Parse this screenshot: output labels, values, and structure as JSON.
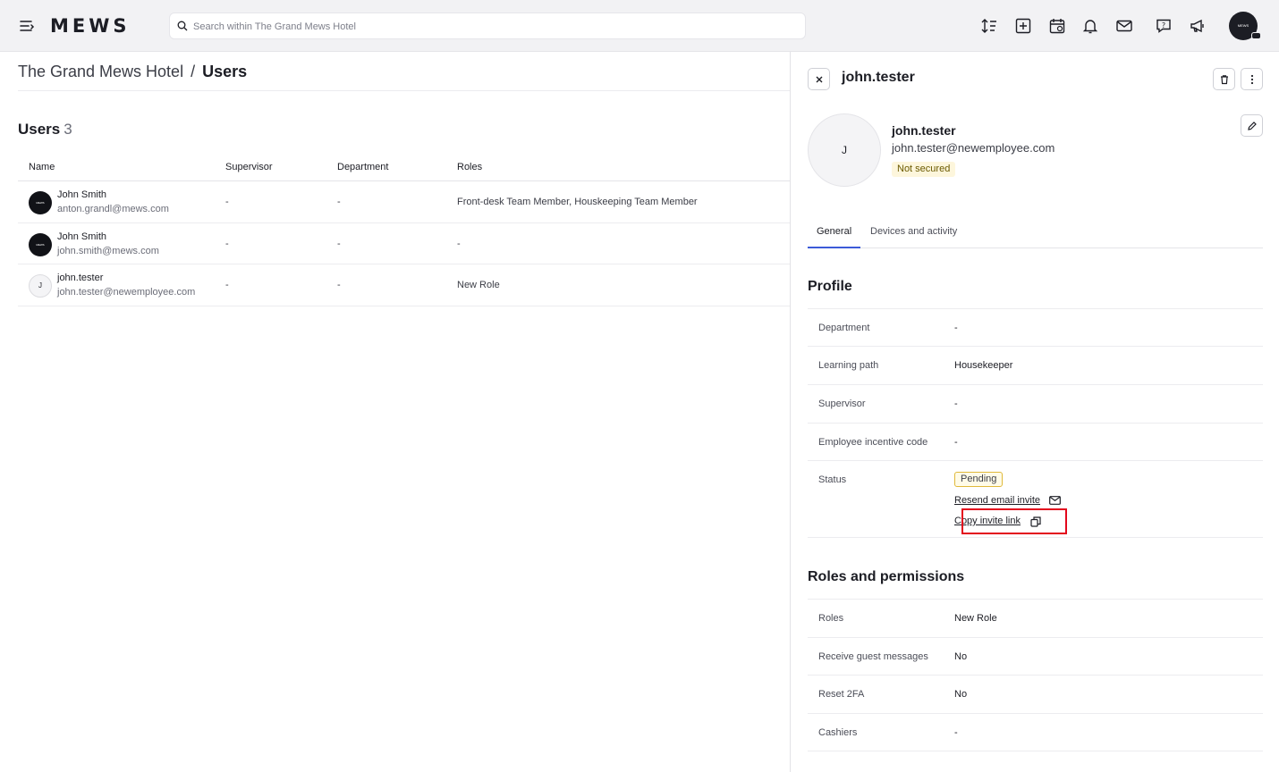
{
  "topbar": {
    "logo": "MEWS",
    "search_placeholder": "Search within The Grand Mews Hotel",
    "avatar_text": "MEWS"
  },
  "breadcrumb": {
    "hotel": "The Grand Mews Hotel",
    "separator": "/",
    "current": "Users"
  },
  "users": {
    "heading": "Users",
    "count": "3",
    "columns": [
      "Name",
      "Supervisor",
      "Department",
      "Roles"
    ],
    "rows": [
      {
        "avatar": "MEWS",
        "name": "John Smith",
        "email": "anton.grandl@mews.com",
        "supervisor": "-",
        "department": "-",
        "roles": "Front-desk Team Member, Houskeeping Team Member"
      },
      {
        "avatar": "MEWS",
        "name": "John Smith",
        "email": "john.smith@mews.com",
        "supervisor": "-",
        "department": "-",
        "roles": "-"
      },
      {
        "avatar": "J",
        "name": "john.tester",
        "email": "john.tester@newemployee.com",
        "supervisor": "-",
        "department": "-",
        "roles": "New Role"
      }
    ]
  },
  "panel": {
    "title": "john.tester",
    "avatar_initial": "J",
    "name": "john.tester",
    "email": "john.tester@newemployee.com",
    "security_badge": "Not secured",
    "tabs": [
      {
        "label": "General",
        "active": true
      },
      {
        "label": "Devices and activity",
        "active": false
      }
    ],
    "profile": {
      "heading": "Profile",
      "fields": [
        {
          "label": "Department",
          "value": "-"
        },
        {
          "label": "Learning path",
          "value": "Housekeeper"
        },
        {
          "label": "Supervisor",
          "value": "-"
        },
        {
          "label": "Employee incentive code",
          "value": "-"
        }
      ],
      "status": {
        "label": "Status",
        "value": "Pending",
        "resend_link": "Resend email invite",
        "copy_link": "Copy invite link"
      }
    },
    "roles": {
      "heading": "Roles and permissions",
      "fields": [
        {
          "label": "Roles",
          "value": "New Role"
        },
        {
          "label": "Receive guest messages",
          "value": "No"
        },
        {
          "label": "Reset 2FA",
          "value": "No"
        },
        {
          "label": "Cashiers",
          "value": "-"
        }
      ]
    }
  },
  "colors": {
    "accent": "#3c5bd8",
    "highlight": "#e3071d",
    "pending_border": "#e0b93a",
    "not_secured_bg": "#fdf6dc"
  }
}
